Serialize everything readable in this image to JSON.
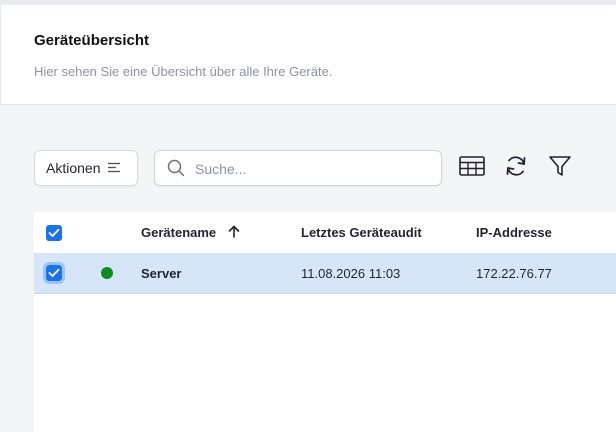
{
  "header": {
    "title": "Geräteübersicht",
    "subtitle": "Hier sehen Sie eine Übersicht über alle Ihre Geräte."
  },
  "toolbar": {
    "actions_label": "Aktionen",
    "actions_icon": "sort-lines-icon",
    "search_placeholder": "Suche...",
    "search_value": "",
    "tools": [
      "table-columns-icon",
      "refresh-icon",
      "filter-icon"
    ]
  },
  "table": {
    "columns": [
      "Gerätename",
      "Letztes Geräteaudit",
      "IP-Addresse"
    ],
    "sort_column": "Gerätename",
    "sort_direction": "ascending",
    "select_all_checked": true,
    "rows": [
      {
        "selected": true,
        "status": "online",
        "status_color": "#0f8a1f",
        "name": "Server",
        "last_audit": "11.08.2026 11:03",
        "ip": "172.22.76.77"
      }
    ]
  },
  "colors": {
    "accent": "#1a73e8",
    "row_selected": "#d6e6f8"
  }
}
